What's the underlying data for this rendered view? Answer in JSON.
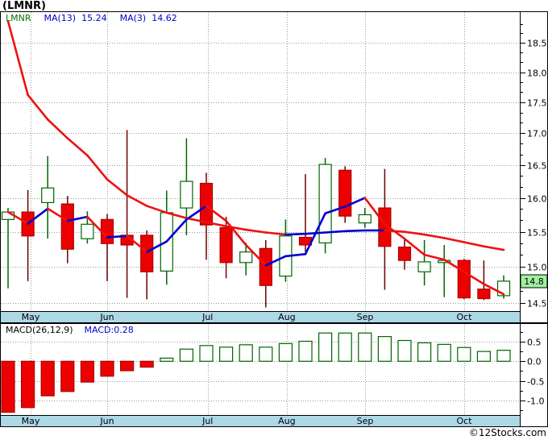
{
  "title": "(LMNR)",
  "price_panel": {
    "legend": {
      "symbol": "LMNR",
      "ma13_label": "MA(13)",
      "ma13_value": "15.24",
      "ma3_label": "MA(3)",
      "ma3_value": "14.62"
    },
    "last_price_badge": "14.8"
  },
  "macd_panel": {
    "legend_label": "MACD(26,12,9)",
    "legend_value": "MACD:0.28"
  },
  "footer": {
    "copyright": "©12Stocks.com"
  },
  "colors": {
    "up": "#006600",
    "up_fill": "#FFFFFF",
    "down": "#EE0000",
    "down_border": "#AA0000",
    "down_wick": "#6B0000",
    "ma_rising": "#0000CC",
    "ma_falling": "#EE1111",
    "grid": "#999999",
    "axis_strip": "#ADD8E6",
    "badge_bg": "#A0F0A0",
    "border": "#000000"
  },
  "chart_data": [
    {
      "type": "candlestick",
      "title": "(LMNR)",
      "interval": "weekly",
      "y_axis_scale": "log",
      "y_ticks": [
        14.5,
        15.0,
        15.5,
        16.0,
        16.5,
        17.0,
        17.5,
        18.0,
        18.5
      ],
      "ylim": [
        14.39,
        19.0
      ],
      "x_labels": [
        "May",
        "Jun",
        "Jul",
        "Aug",
        "Sep",
        "Oct"
      ],
      "x_label_candle_pos": [
        1.14,
        5.0,
        10.07,
        14.06,
        18.01,
        23.01
      ],
      "last_price": 14.8,
      "ohlc_order": [
        "open",
        "high",
        "low",
        "close"
      ],
      "candles": [
        [
          15.68,
          15.85,
          14.7,
          15.79
        ],
        [
          15.79,
          16.12,
          14.8,
          15.44
        ],
        [
          15.93,
          16.64,
          15.4,
          16.15
        ],
        [
          15.91,
          16.03,
          15.05,
          15.25
        ],
        [
          15.4,
          15.8,
          15.33,
          15.61
        ],
        [
          15.68,
          15.76,
          14.8,
          15.33
        ],
        [
          15.45,
          17.05,
          14.57,
          15.31
        ],
        [
          15.45,
          15.52,
          14.55,
          14.93
        ],
        [
          14.94,
          16.11,
          14.75,
          15.78
        ],
        [
          15.85,
          16.92,
          15.45,
          16.25
        ],
        [
          16.22,
          16.38,
          15.1,
          15.6
        ],
        [
          15.56,
          15.72,
          14.84,
          15.06
        ],
        [
          15.06,
          15.34,
          14.88,
          15.21
        ],
        [
          15.26,
          15.38,
          14.44,
          14.74
        ],
        [
          14.87,
          15.68,
          14.79,
          15.44
        ],
        [
          15.42,
          16.36,
          15.21,
          15.31
        ],
        [
          15.34,
          16.61,
          15.19,
          16.51
        ],
        [
          16.42,
          16.48,
          15.63,
          15.73
        ],
        [
          15.63,
          15.85,
          15.56,
          15.75
        ],
        [
          15.85,
          16.44,
          14.68,
          15.29
        ],
        [
          15.28,
          15.4,
          14.96,
          15.09
        ],
        [
          14.93,
          15.38,
          14.74,
          15.07
        ],
        [
          15.06,
          15.31,
          14.58,
          15.09
        ],
        [
          15.09,
          15.11,
          14.55,
          14.57
        ],
        [
          14.69,
          15.09,
          14.54,
          14.56
        ],
        [
          14.6,
          14.88,
          14.56,
          14.8
        ]
      ],
      "series": [
        {
          "name": "MA(13)",
          "last_value": 15.24,
          "values": [
            18.88,
            17.62,
            17.22,
            16.92,
            16.65,
            16.28,
            16.04,
            15.88,
            15.78,
            15.7,
            15.64,
            15.58,
            15.53,
            15.49,
            15.46,
            15.47,
            15.49,
            15.51,
            15.52,
            15.52,
            15.5,
            15.46,
            15.41,
            15.35,
            15.29,
            15.24
          ]
        },
        {
          "name": "MA(3)",
          "last_value": 14.62,
          "values": [
            15.79,
            15.62,
            15.84,
            15.66,
            15.72,
            15.42,
            15.44,
            15.21,
            15.36,
            15.68,
            15.88,
            15.66,
            15.31,
            15.02,
            15.15,
            15.18,
            15.77,
            15.87,
            16.0,
            15.61,
            15.4,
            15.17,
            15.1,
            14.93,
            14.76,
            14.62
          ]
        }
      ]
    },
    {
      "type": "bar",
      "name": "MACD(26,12,9)",
      "current": 0.28,
      "y_ticks": [
        0.5,
        0.0,
        -0.5,
        -1.0
      ],
      "ylim": [
        -1.35,
        0.95
      ],
      "x_labels": [
        "May",
        "Jun",
        "Jul",
        "Aug",
        "Sep",
        "Oct"
      ],
      "x_label_candle_pos": [
        1.14,
        5.0,
        10.07,
        14.06,
        18.01,
        23.01
      ],
      "values": [
        -1.3,
        -1.18,
        -0.88,
        -0.77,
        -0.53,
        -0.38,
        -0.24,
        -0.15,
        0.08,
        0.31,
        0.4,
        0.36,
        0.42,
        0.36,
        0.45,
        0.51,
        0.72,
        0.72,
        0.72,
        0.63,
        0.53,
        0.47,
        0.43,
        0.35,
        0.25,
        0.28
      ]
    }
  ]
}
